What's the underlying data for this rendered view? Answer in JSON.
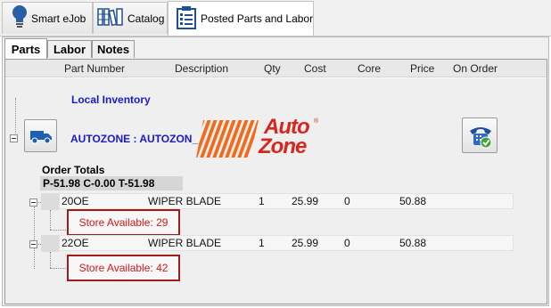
{
  "top_tabs": [
    {
      "label": "Smart eJob",
      "icon": "lightbulb-icon"
    },
    {
      "label": "Catalog",
      "icon": "books-icon"
    },
    {
      "label": "Posted Parts and Labor",
      "icon": "clipboard-list-icon",
      "active": true
    }
  ],
  "sub_tabs": [
    {
      "label": "Parts",
      "active": true
    },
    {
      "label": "Labor"
    },
    {
      "label": "Notes"
    }
  ],
  "columns": [
    "Part Number",
    "Description",
    "Qty",
    "Cost",
    "Core",
    "Price",
    "On Order"
  ],
  "local_inventory_label": "Local Inventory",
  "vendor": {
    "name": "AUTOZONE : AUTOZON_",
    "logo_text_line1": "Auto",
    "logo_text_line2": "Zone",
    "logo_registered": "®"
  },
  "order_totals": {
    "label": "Order Totals",
    "summary": "P-51.98 C-0.00 T-51.98"
  },
  "parts": [
    {
      "part_number": "20OE",
      "description": "WIPER BLADE",
      "qty": "1",
      "cost": "25.99",
      "core": "0",
      "price": "50.88",
      "store_available": "Store Available: 29"
    },
    {
      "part_number": "22OE",
      "description": "WIPER BLADE",
      "qty": "1",
      "cost": "25.99",
      "core": "0",
      "price": "50.88",
      "store_available": "Store Available: 42"
    }
  ],
  "colors": {
    "link_blue": "#1a1acc",
    "autozone_orange": "#f26a1b",
    "autozone_red": "#d7261e",
    "store_red": "#d01818",
    "highlight_box": "#a31a1a"
  }
}
